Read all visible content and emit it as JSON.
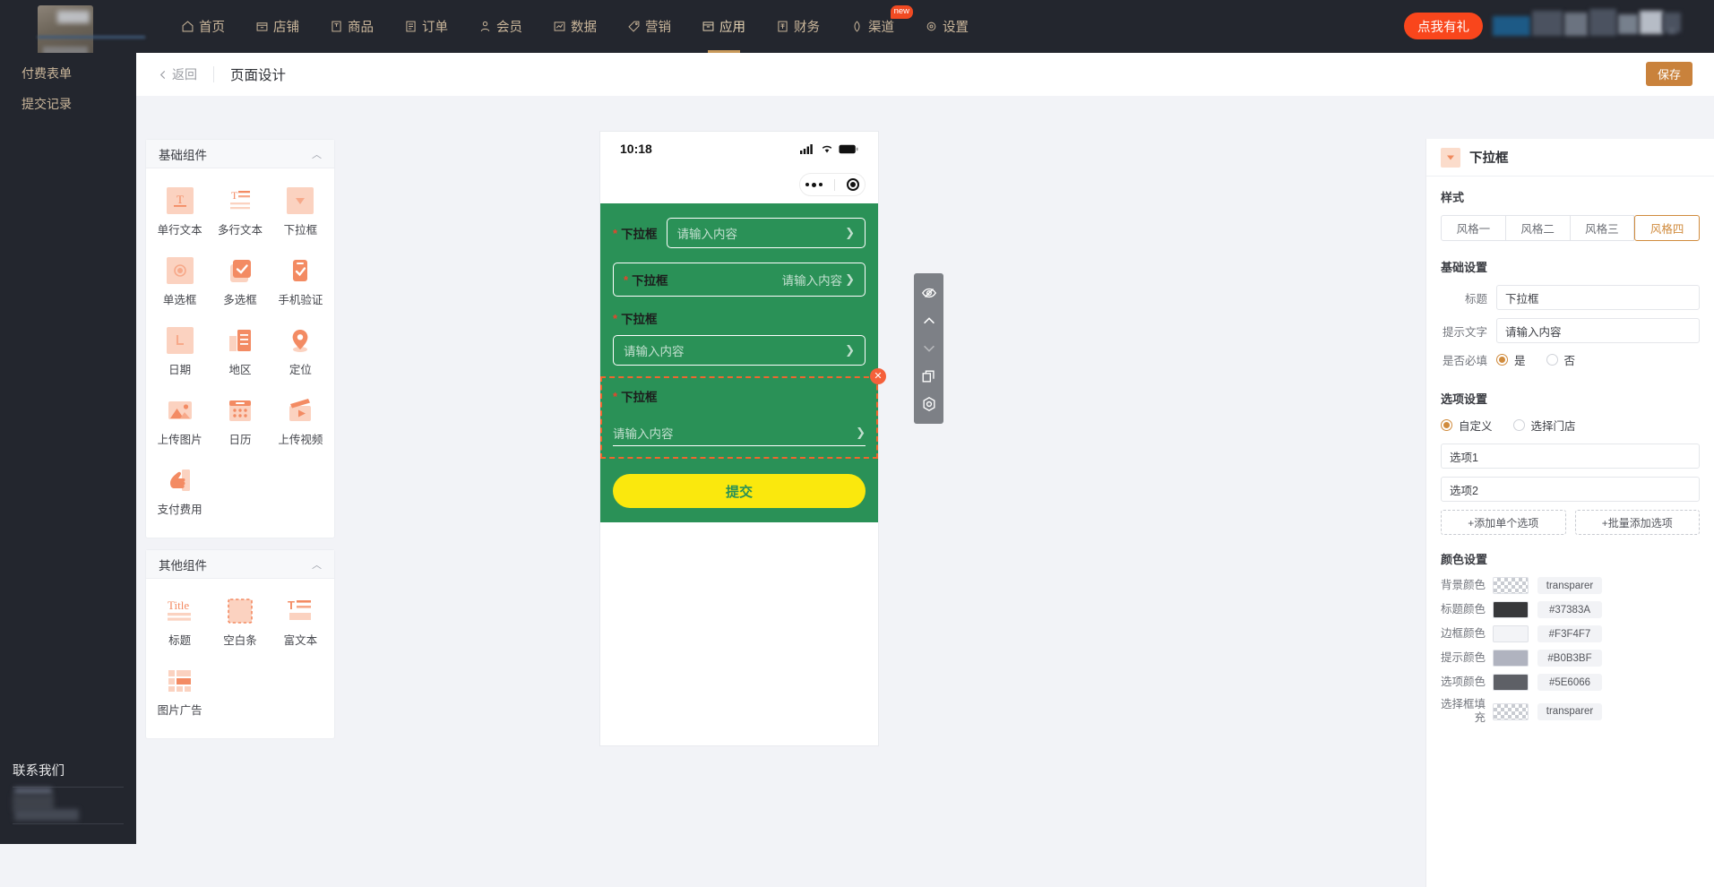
{
  "topnav": {
    "items": [
      {
        "label": "首页",
        "icon": "home-icon",
        "active": false
      },
      {
        "label": "店铺",
        "icon": "shop-icon",
        "active": false
      },
      {
        "label": "商品",
        "icon": "goods-icon",
        "active": false
      },
      {
        "label": "订单",
        "icon": "order-icon",
        "active": false
      },
      {
        "label": "会员",
        "icon": "member-icon",
        "active": false
      },
      {
        "label": "数据",
        "icon": "chart-icon",
        "active": false
      },
      {
        "label": "营销",
        "icon": "tag-icon",
        "active": false
      },
      {
        "label": "应用",
        "icon": "apps-icon",
        "active": true
      },
      {
        "label": "财务",
        "icon": "finance-icon",
        "active": false
      },
      {
        "label": "渠道",
        "icon": "channel-icon",
        "active": false,
        "badge": "new"
      },
      {
        "label": "设置",
        "icon": "gear-icon",
        "active": false
      }
    ],
    "gift_button": "点我有礼"
  },
  "sidebar": {
    "items": [
      {
        "label": "付费表单",
        "icon": "form-icon"
      },
      {
        "label": "提交记录",
        "icon": "records-icon"
      }
    ],
    "contact_title": "联系我们"
  },
  "header": {
    "back_label": "返回",
    "title": "页面设计",
    "save_label": "保存"
  },
  "palette": {
    "groups": [
      {
        "title": "基础组件",
        "items": [
          {
            "label": "单行文本",
            "icon": "single-line-text-icon"
          },
          {
            "label": "多行文本",
            "icon": "multi-line-text-icon"
          },
          {
            "label": "下拉框",
            "icon": "dropdown-icon"
          },
          {
            "label": "单选框",
            "icon": "radio-icon"
          },
          {
            "label": "多选框",
            "icon": "checkbox-icon"
          },
          {
            "label": "手机验证",
            "icon": "phone-verify-icon"
          },
          {
            "label": "日期",
            "icon": "date-icon"
          },
          {
            "label": "地区",
            "icon": "region-icon"
          },
          {
            "label": "定位",
            "icon": "location-icon"
          },
          {
            "label": "上传图片",
            "icon": "upload-image-icon"
          },
          {
            "label": "日历",
            "icon": "calendar-icon"
          },
          {
            "label": "上传视频",
            "icon": "upload-video-icon"
          },
          {
            "label": "支付费用",
            "icon": "payment-icon"
          }
        ]
      },
      {
        "title": "其他组件",
        "items": [
          {
            "label": "标题",
            "icon": "title-icon"
          },
          {
            "label": "空白条",
            "icon": "blank-bar-icon"
          },
          {
            "label": "富文本",
            "icon": "rich-text-icon"
          },
          {
            "label": "图片广告",
            "icon": "image-ad-icon"
          }
        ]
      }
    ]
  },
  "preview": {
    "status_time": "10:18",
    "fields": [
      {
        "style": "s1",
        "label": "下拉框",
        "placeholder": "请输入内容",
        "required": true
      },
      {
        "style": "s2",
        "label": "下拉框",
        "placeholder": "请输入内容",
        "required": true
      },
      {
        "style": "s3",
        "label": "下拉框",
        "placeholder": "请输入内容",
        "required": true
      },
      {
        "style": "s4",
        "label": "下拉框",
        "placeholder": "请输入内容",
        "required": true,
        "selected": true
      }
    ],
    "submit_label": "提交",
    "close_glyph": "✕",
    "toolbar": [
      {
        "icon": "eye-slash-icon",
        "disabled": false
      },
      {
        "icon": "arrow-up-icon",
        "disabled": false
      },
      {
        "icon": "arrow-down-icon",
        "disabled": true
      },
      {
        "icon": "copy-icon",
        "disabled": false
      },
      {
        "icon": "settings-hex-icon",
        "disabled": false
      }
    ],
    "bg_color": "#2a9157",
    "submit_bg": "#fae80d"
  },
  "properties": {
    "component_title": "下拉框",
    "style_section": {
      "title": "样式",
      "options": [
        "风格一",
        "风格二",
        "风格三",
        "风格四"
      ],
      "selected": "风格四"
    },
    "basic_section": {
      "title": "基础设置",
      "title_label": "标题",
      "title_value": "下拉框",
      "placeholder_label": "提示文字",
      "placeholder_value": "请输入内容",
      "required_label": "是否必填",
      "required_yes": "是",
      "required_no": "否",
      "required_selected": "是"
    },
    "option_section": {
      "title": "选项设置",
      "source_custom": "自定义",
      "source_store": "选择门店",
      "source_selected": "自定义",
      "options": [
        "选项1",
        "选项2"
      ],
      "add_single": "+添加单个选项",
      "add_batch": "+批量添加选项"
    },
    "color_section": {
      "title": "颜色设置",
      "rows": [
        {
          "label": "背景颜色",
          "value": "transparer",
          "swatch": "checker"
        },
        {
          "label": "标题颜色",
          "value": "#37383A",
          "swatch": "#37383A"
        },
        {
          "label": "边框颜色",
          "value": "#F3F4F7",
          "swatch": "#F3F4F7"
        },
        {
          "label": "提示颜色",
          "value": "#B0B3BF",
          "swatch": "#B0B3BF"
        },
        {
          "label": "选项颜色",
          "value": "#5E6066",
          "swatch": "#5E6066"
        },
        {
          "label": "选择框填充",
          "value": "transparer",
          "swatch": "checker"
        }
      ]
    }
  }
}
